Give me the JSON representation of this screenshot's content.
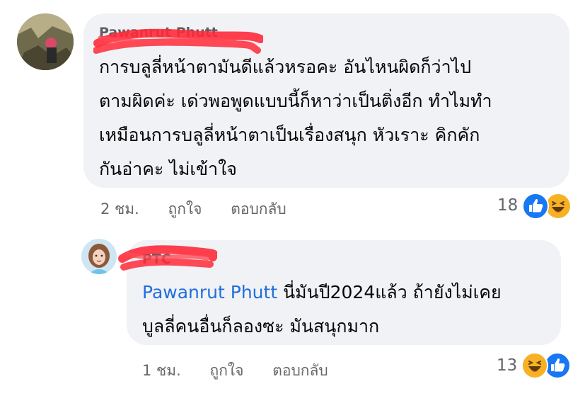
{
  "comments": [
    {
      "author": "Pawanrut Phutt",
      "lines": [
        "การบลูลี่หน้าตามันดีแล้วหรอคะ อันไหนผิดก็ว่าไป",
        "ตามผิดค่ะ เด่วพอพูดแบบนี้ก็หาว่าเป็นติ่งอีก ทำไมทำ",
        "เหมือนการบลูลี่หน้าตาเป็นเรื่องสนุก หัวเราะ คิกคัก",
        "กันอ่าคะ ไม่เข้าใจ"
      ],
      "time": "2 ชม.",
      "like_label": "ถูกใจ",
      "reply_label": "ตอบกลับ",
      "reaction_count": "18",
      "reactions": [
        "like-icon",
        "haha-icon"
      ]
    },
    {
      "author": "PTC",
      "mention": "Pawanrut Phutt",
      "line1_rest": " นี่มันปี2024แล้ว ถ้ายังไม่เคย",
      "line2": "บูลลี่คนอื่นก็ลองซะ มันสนุกมาก",
      "time": "1 ชม.",
      "like_label": "ถูกใจ",
      "reply_label": "ตอบกลับ",
      "reaction_count": "13",
      "reactions": [
        "haha-icon",
        "like-icon"
      ]
    }
  ],
  "colors": {
    "bubble": "#f0f2f5",
    "text": "#050505",
    "meta": "#65676b",
    "mention": "#216fdb",
    "scribble": "#ff2a3a",
    "like": "#1877f2",
    "haha": "#f7b125"
  }
}
